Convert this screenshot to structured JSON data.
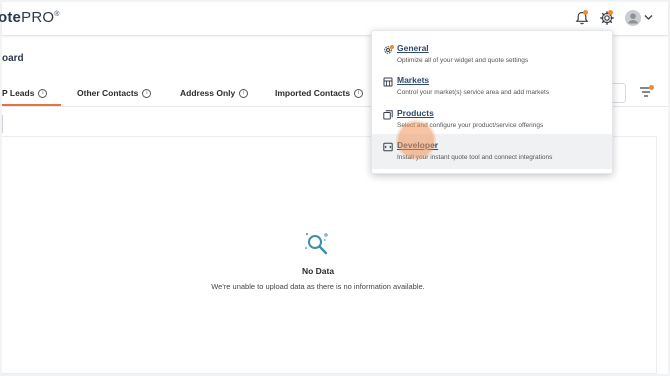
{
  "header": {
    "logo_text": "ote",
    "logo_pro": "PRO",
    "logo_mark": "®",
    "icons": [
      "bell-icon",
      "gear-icon",
      "user-avatar-icon",
      "chevron-down-icon"
    ],
    "notification_color": "#f08a2c"
  },
  "page": {
    "title": "oard"
  },
  "tabs": [
    {
      "label": "P Leads",
      "active": true
    },
    {
      "label": "Other Contacts",
      "active": false
    },
    {
      "label": "Address Only",
      "active": false
    },
    {
      "label": "Imported Contacts",
      "active": false
    }
  ],
  "settings_menu": {
    "items": [
      {
        "title": "General",
        "description": "Optimize all of your widget and quote settings",
        "icon": "gear-icon"
      },
      {
        "title": "Markets",
        "description": "Control your market(s) service area and add markets",
        "icon": "store-icon"
      },
      {
        "title": "Products",
        "description": "Select and configure your product/service offerings",
        "icon": "products-icon"
      },
      {
        "title": "Developer",
        "description": "Install your instant quote tool and connect integrations",
        "icon": "code-icon",
        "hovered": true
      }
    ]
  },
  "empty_state": {
    "title": "No Data",
    "description": "We're unable to upload data as there is no information available.",
    "icon": "search-icon"
  },
  "colors": {
    "accent": "#e8723b",
    "link": "#2e4a6b",
    "icon_teal": "#3d8ea8"
  }
}
